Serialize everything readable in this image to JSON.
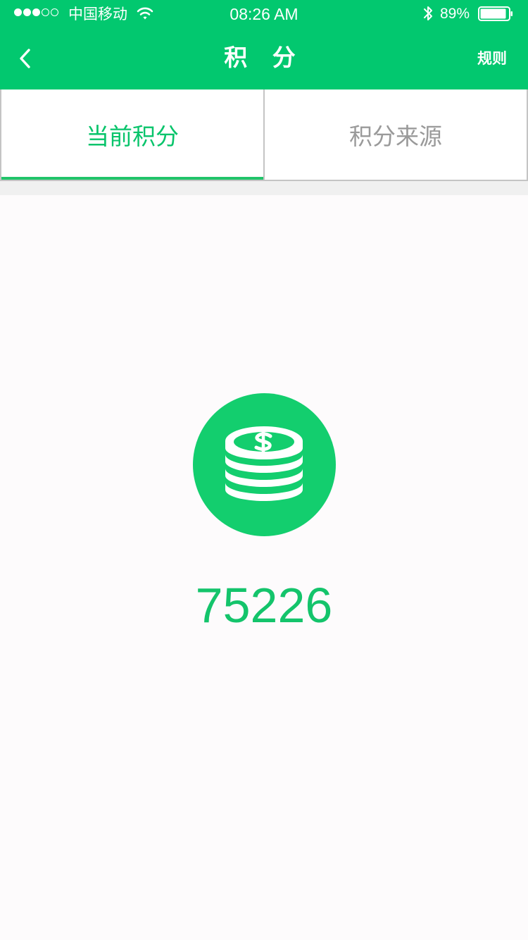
{
  "status_bar": {
    "carrier": "中国移动",
    "time": "08:26 AM",
    "battery": "89%",
    "signal_bars_filled": 3,
    "signal_bars_total": 5
  },
  "header": {
    "back_icon": "chevron-left-icon",
    "title": "积 分",
    "rules": "规则",
    "background_color": "#02c86f"
  },
  "tabs": [
    {
      "label": "当前积分",
      "active": true
    },
    {
      "label": "积分来源",
      "active": false
    }
  ],
  "points": {
    "icon": "coin-stack-dollar-icon",
    "value": "75226",
    "accent_color": "#14c46b"
  }
}
